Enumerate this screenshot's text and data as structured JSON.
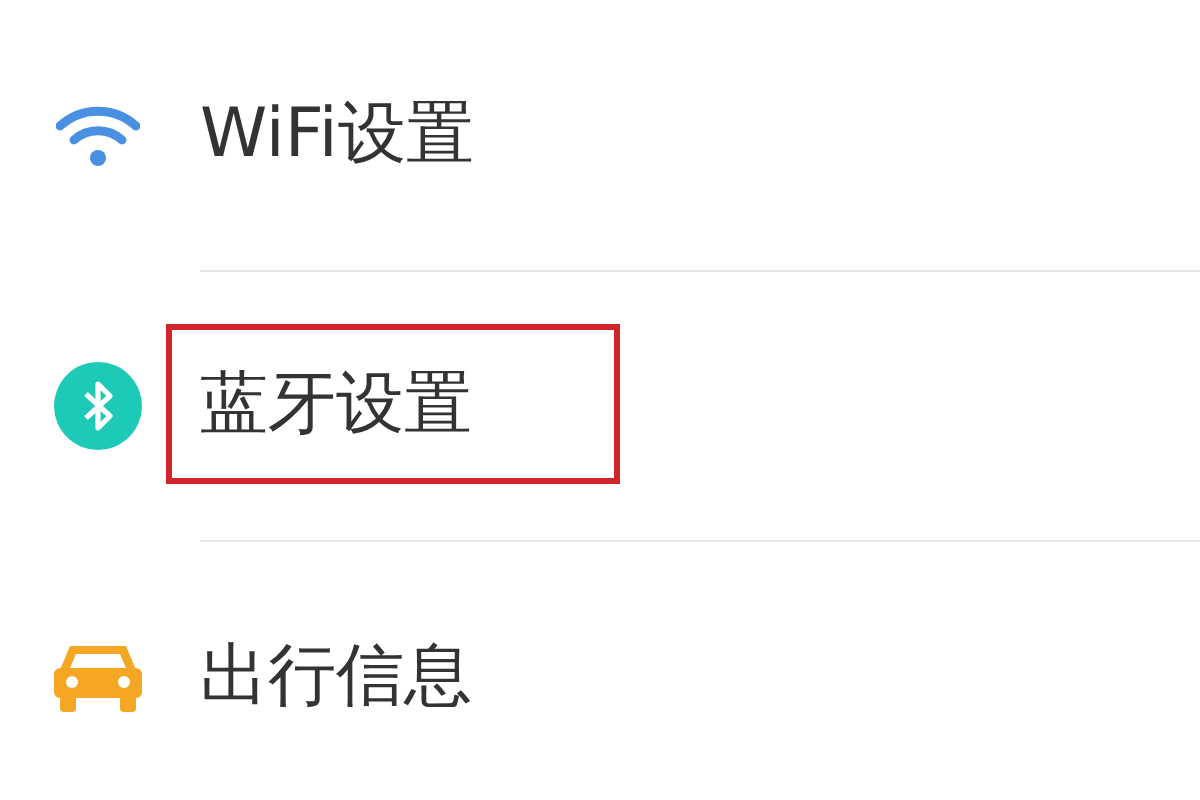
{
  "settings_items": [
    {
      "kind": "wifi",
      "label": "WiFi设置",
      "highlighted": false
    },
    {
      "kind": "bluetooth",
      "label": "蓝牙设置",
      "highlighted": true
    },
    {
      "kind": "car",
      "label": "出行信息",
      "highlighted": false
    }
  ]
}
